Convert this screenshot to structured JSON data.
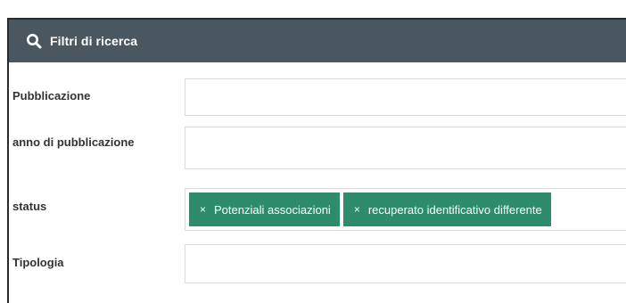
{
  "header": {
    "title": "Filtri di ricerca",
    "icon": "search-icon"
  },
  "fields": [
    {
      "label": "Pubblicazione",
      "value": ""
    },
    {
      "label": "anno di pubblicazione",
      "value": ""
    },
    {
      "label": "status",
      "tags": [
        "Potenziali associazioni",
        "recuperato identificativo differente"
      ]
    },
    {
      "label": "Tipologia",
      "value": ""
    }
  ],
  "colors": {
    "header_bg": "#4b5760",
    "tag_bg": "#2e8b6b",
    "field_border": "#dcdcdc"
  }
}
